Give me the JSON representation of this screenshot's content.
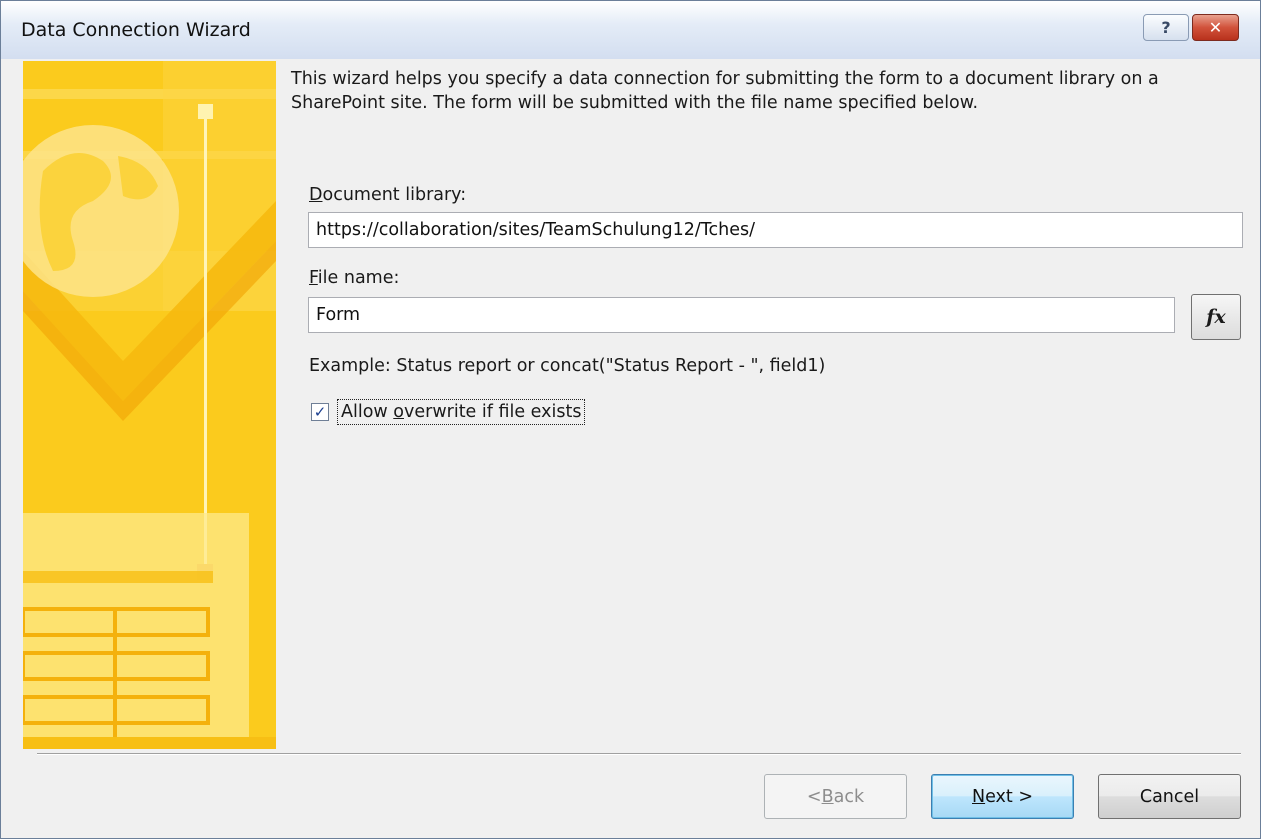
{
  "window": {
    "title": "Data Connection Wizard",
    "help_glyph": "?",
    "close_glyph": "✕"
  },
  "intro": "This wizard helps you specify a data connection for submitting the form to a document library on a SharePoint site. The form will be submitted with the file name specified below.",
  "document_library": {
    "label_accel": "D",
    "label_rest": "ocument library:",
    "value": "https://collaboration/sites/TeamSchulung12/Tches/"
  },
  "file_name": {
    "label_accel": "F",
    "label_rest": "ile name:",
    "value": "Form",
    "formula_button": "fx"
  },
  "example": "Example: Status report or concat(\"Status Report - \", field1)",
  "overwrite": {
    "checked": true,
    "label_before": "Allow ",
    "label_accel": "o",
    "label_after": "verwrite if file exists",
    "check_glyph": "✓"
  },
  "buttons": {
    "back_before": "< ",
    "back_accel": "B",
    "back_after": "ack",
    "next_accel": "N",
    "next_after": "ext >",
    "cancel": "Cancel"
  },
  "colors": {
    "title_gradient_end": "#d3def0",
    "art_base": "#fbcb1d",
    "default_button_border": "#3c7fb1",
    "close_button": "#c8402a"
  },
  "icons": [
    "help-icon",
    "close-icon",
    "wizard-art",
    "globe-icon",
    "function-icon",
    "checkmark-icon"
  ]
}
